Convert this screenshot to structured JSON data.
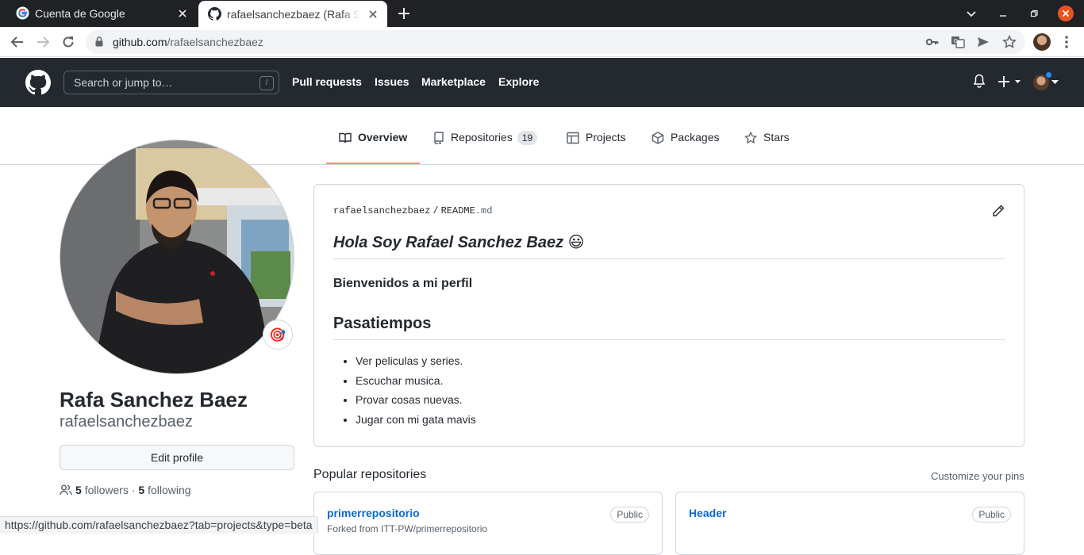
{
  "browser": {
    "tabs": [
      {
        "title": "Cuenta de Google",
        "active": false,
        "favicon": "google-g-icon"
      },
      {
        "title": "rafaelsanchezbaez (Rafa Sanchez Baez)",
        "active": true,
        "favicon": "github-icon"
      }
    ],
    "url": {
      "host": "github.com",
      "path": "/rafaelsanchezbaez"
    },
    "status_bar": "https://github.com/rafaelsanchezbaez?tab=projects&type=beta"
  },
  "github_header": {
    "search_placeholder": "Search or jump to…",
    "search_shortcut": "/",
    "nav": [
      "Pull requests",
      "Issues",
      "Marketplace",
      "Explore"
    ]
  },
  "profile_tabs": [
    {
      "label": "Overview",
      "icon": "book-icon",
      "active": true
    },
    {
      "label": "Repositories",
      "icon": "repo-icon",
      "count": "19"
    },
    {
      "label": "Projects",
      "icon": "table-icon"
    },
    {
      "label": "Packages",
      "icon": "package-icon"
    },
    {
      "label": "Stars",
      "icon": "star-icon"
    }
  ],
  "profile": {
    "full_name": "Rafa Sanchez Baez",
    "username": "rafaelsanchezbaez",
    "status_emoji": "🎯",
    "edit_button": "Edit profile",
    "followers_count": "5",
    "followers_label": "followers",
    "separator": "·",
    "following_count": "5",
    "following_label": "following"
  },
  "readme": {
    "owner": "rafaelsanchezbaez",
    "sep": "/",
    "file_base": "README",
    "file_ext": ".md",
    "heading": "Hola Soy Rafael Sanchez Baez 😃",
    "subheading": "Bienvenidos a mi perfil",
    "section_title": "Pasatiempos",
    "hobbies": [
      "Ver peliculas y series.",
      "Escuchar musica.",
      "Provar cosas nuevas.",
      "Jugar con mi gata mavis"
    ]
  },
  "popular": {
    "title": "Popular repositories",
    "customize": "Customize your pins",
    "repos": [
      {
        "name": "primerrepositorio",
        "visibility": "Public",
        "forked_from": "Forked from ITT-PW/primerrepositorio"
      },
      {
        "name": "Header",
        "visibility": "Public"
      }
    ]
  },
  "colors": {
    "header_bg": "#24292f",
    "link": "#0969da",
    "active_tab_underline": "#fd8c73"
  }
}
